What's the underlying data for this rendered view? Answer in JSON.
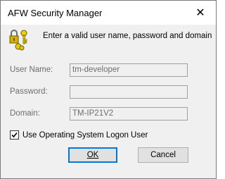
{
  "window": {
    "title": "AFW Security Manager",
    "close_glyph": "✕"
  },
  "message": "Enter a valid user name, password and domain",
  "fields": {
    "username": {
      "label": "User Name:",
      "value": "tm-developer"
    },
    "password": {
      "label": "Password:",
      "value": ""
    },
    "domain": {
      "label": "Domain:",
      "value": "TM-IP21V2"
    }
  },
  "checkbox": {
    "label": "Use Operating System Logon User",
    "checked": true
  },
  "buttons": {
    "ok": "OK",
    "cancel": "Cancel"
  },
  "icons": {
    "dialog_icon": "keys-lock-icon",
    "close": "close-icon"
  },
  "colors": {
    "accent": "#0078d7",
    "disabled_text": "#6d6d6d"
  }
}
